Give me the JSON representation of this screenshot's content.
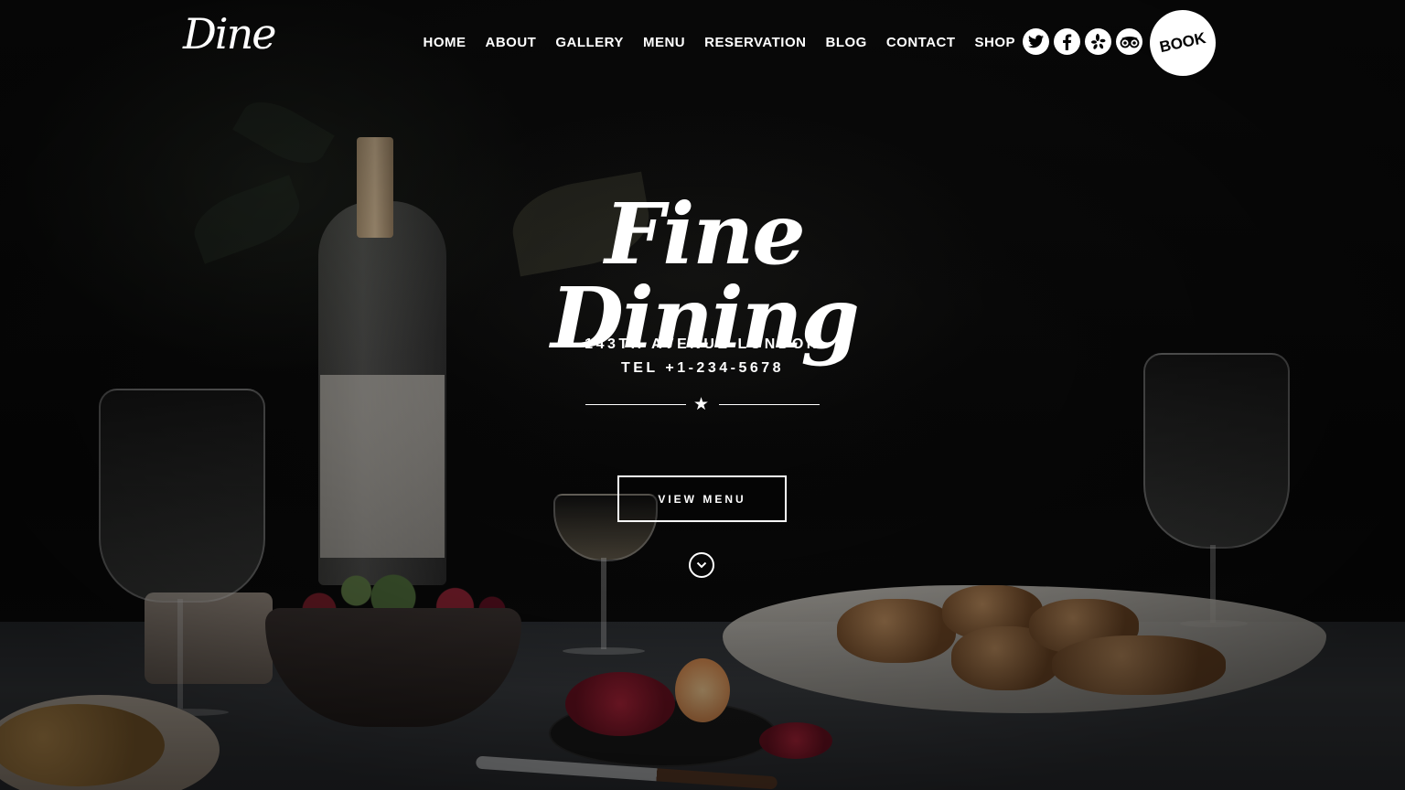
{
  "header": {
    "logo_text": "Dine",
    "nav": [
      {
        "label": "HOME"
      },
      {
        "label": "ABOUT"
      },
      {
        "label": "GALLERY"
      },
      {
        "label": "MENU"
      },
      {
        "label": "RESERVATION"
      },
      {
        "label": "BLOG"
      },
      {
        "label": "CONTACT"
      },
      {
        "label": "SHOP"
      }
    ],
    "social_icons": [
      "twitter-icon",
      "facebook-icon",
      "yelp-icon",
      "tripadvisor-icon"
    ],
    "book_label": "BOOK"
  },
  "hero": {
    "title": "Fine Dining",
    "address": "143TH AVENUE LONDON",
    "phone": "TEL +1-234-5678",
    "divider_icon": "star-icon",
    "cta_label": "VIEW MENU",
    "scroll_icon": "chevron-down-icon"
  },
  "colors": {
    "background": "#0b0b0b",
    "text": "#ffffff",
    "book_bg": "#ffffff"
  }
}
